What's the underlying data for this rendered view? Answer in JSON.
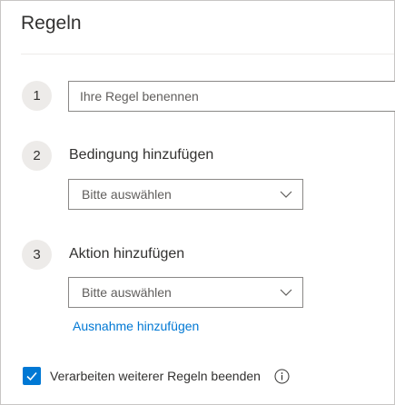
{
  "panel": {
    "title": "Regeln"
  },
  "steps": [
    {
      "number": "1",
      "input_placeholder": "Ihre Regel benennen"
    },
    {
      "number": "2",
      "label": "Bedingung hinzufügen",
      "dropdown_value": "Bitte auswählen"
    },
    {
      "number": "3",
      "label": "Aktion hinzufügen",
      "dropdown_value": "Bitte auswählen"
    }
  ],
  "exception_link": "Ausnahme hinzufügen",
  "stop_processing": {
    "label": "Verarbeiten weiterer Regeln beenden",
    "checked": true
  },
  "icons": {
    "chevron": "chevron-down-icon",
    "check": "checkmark-icon",
    "info": "info-icon"
  },
  "colors": {
    "accent": "#0078d4",
    "step_circle": "#edebe9",
    "border": "#8a8886"
  }
}
